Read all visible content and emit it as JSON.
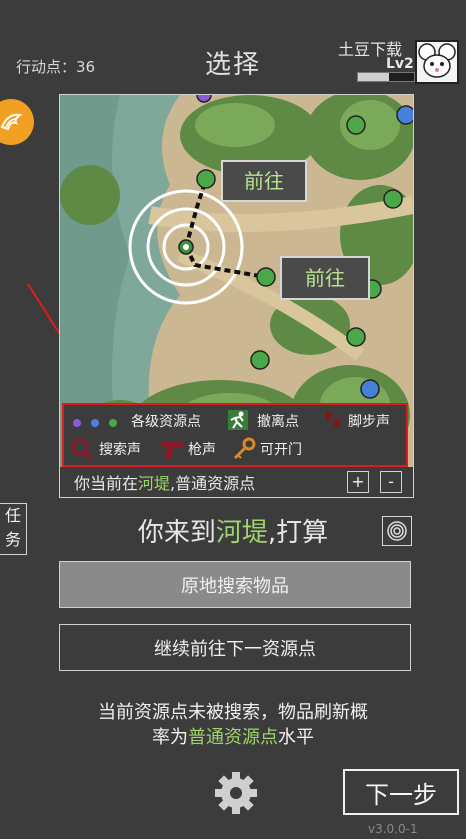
{
  "header": {
    "action_points": "行动点：36",
    "title": "选择",
    "user_name": "土豆下载",
    "level": "Lv2",
    "level_progress": 0.55
  },
  "sidebar": {
    "task_label": "任务"
  },
  "map": {
    "goto_1": "前往",
    "goto_2": "前往",
    "legend": {
      "resource_points": "各级资源点",
      "evacuation_point": "撤离点",
      "footsteps": "脚步声",
      "search_sound": "搜索声",
      "gunshot": "枪声",
      "openable_door": "可开门"
    },
    "legend_dot_colors": [
      "#8a5ad8",
      "#4f7fe6",
      "#4aa84a"
    ],
    "status_prefix": "你当前在",
    "status_location": "河堤",
    "status_suffix": ",普通资源点",
    "zoom_in": "+",
    "zoom_out": "-"
  },
  "question": {
    "prefix": "你来到",
    "location": "河堤",
    "suffix": ",打算"
  },
  "actions": {
    "search_label": "原地搜索物品",
    "continue_label": "继续前往下一资源点"
  },
  "info": {
    "line1": "当前资源点未被搜索，物品刷新概",
    "line2_prefix": "率为",
    "line2_highlight": "普通资源点",
    "line2_suffix": "水平"
  },
  "footer": {
    "next_label": "下一步",
    "version": "v3.0.0-1"
  },
  "colors": {
    "accent_green": "#9fd36b",
    "highlight_red": "#e01b1b",
    "orange": "#f2a024"
  },
  "icons": [
    "settings-gear-icon",
    "target-icon",
    "running-man-icon",
    "footprint-icon",
    "magnifier-icon",
    "pistol-icon",
    "key-icon"
  ]
}
